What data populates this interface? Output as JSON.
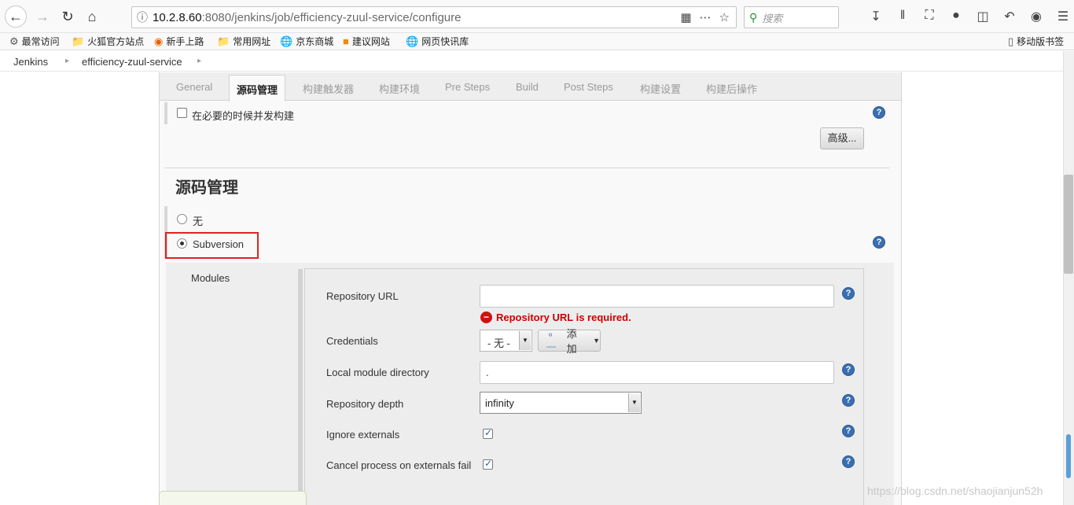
{
  "browser": {
    "url_host": "10.2.8.60",
    "url_path": ":8080/jenkins/job/efficiency-zuul-service/configure",
    "search_placeholder": "搜索",
    "bookmarks": [
      "最常访问",
      "火狐官方站点",
      "新手上路",
      "常用网址",
      "京东商城",
      "建议网站",
      "网页快讯库"
    ],
    "mobile_bookmarks": "移动版书签"
  },
  "breadcrumb": [
    "Jenkins",
    "efficiency-zuul-service"
  ],
  "tabs": [
    "General",
    "源码管理",
    "构建触发器",
    "构建环境",
    "Pre Steps",
    "Build",
    "Post Steps",
    "构建设置",
    "构建后操作"
  ],
  "active_tab_index": 1,
  "general": {
    "concurrent_build_label": "在必要的时候并发构建",
    "concurrent_build_checked": false,
    "advanced_button": "高级..."
  },
  "scm": {
    "section_title": "源码管理",
    "option_none": "无",
    "option_subversion": "Subversion",
    "selected": "Subversion",
    "modules_label": "Modules",
    "repository_url_label": "Repository URL",
    "repository_url_value": "",
    "repository_url_error": "Repository URL is required.",
    "credentials_label": "Credentials",
    "credentials_value": "- 无 -",
    "add_button": "添加",
    "local_module_dir_label": "Local module directory",
    "local_module_dir_value": ".",
    "repository_depth_label": "Repository depth",
    "repository_depth_value": "infinity",
    "ignore_externals_label": "Ignore externals",
    "ignore_externals_checked": true,
    "cancel_externals_label": "Cancel process on externals fail",
    "cancel_externals_checked": true
  },
  "help_icon_text": "?",
  "watermark": "https://blog.csdn.net/shaojianjun52h"
}
